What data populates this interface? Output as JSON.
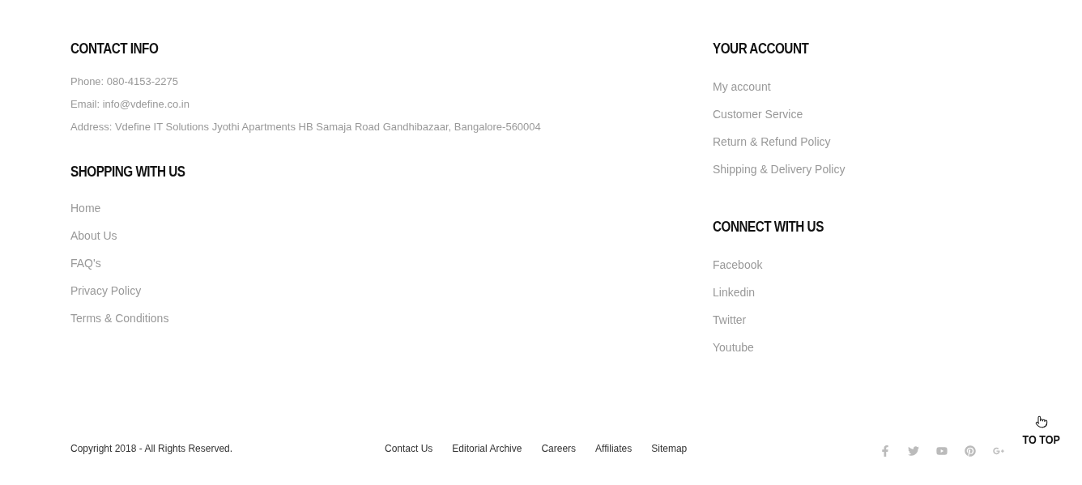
{
  "contact_info": {
    "heading": "CONTACT INFO",
    "lines": [
      "Phone: 080-4153-2275",
      "Email: info@vdefine.co.in",
      "Address: Vdefine IT Solutions Jyothi Apartments HB Samaja Road Gandhibazaar, Bangalore-560004"
    ]
  },
  "shopping_with_us": {
    "heading": "SHOPPING WITH US",
    "links": [
      "Home",
      "About Us",
      "FAQ's",
      "Privacy Policy",
      "Terms & Conditions"
    ]
  },
  "your_account": {
    "heading": "YOUR ACCOUNT",
    "links": [
      "My account",
      "Customer Service",
      "Return & Refund Policy",
      "Shipping & Delivery Policy"
    ]
  },
  "connect_with_us": {
    "heading": "CONNECT WITH US",
    "links": [
      "Facebook",
      "Linkedin",
      "Twitter",
      "Youtube"
    ]
  },
  "bottom_bar": {
    "copyright": "Copyright 2018 - All Rights Reserved.",
    "links": [
      "Contact Us",
      "Editorial Archive",
      "Careers",
      "Affiliates",
      "Sitemap"
    ],
    "social": [
      {
        "kind": "facebook"
      },
      {
        "kind": "twitter"
      },
      {
        "kind": "youtube"
      },
      {
        "kind": "pinterest"
      },
      {
        "kind": "googleplus"
      }
    ],
    "to_top": "TO TOP"
  }
}
